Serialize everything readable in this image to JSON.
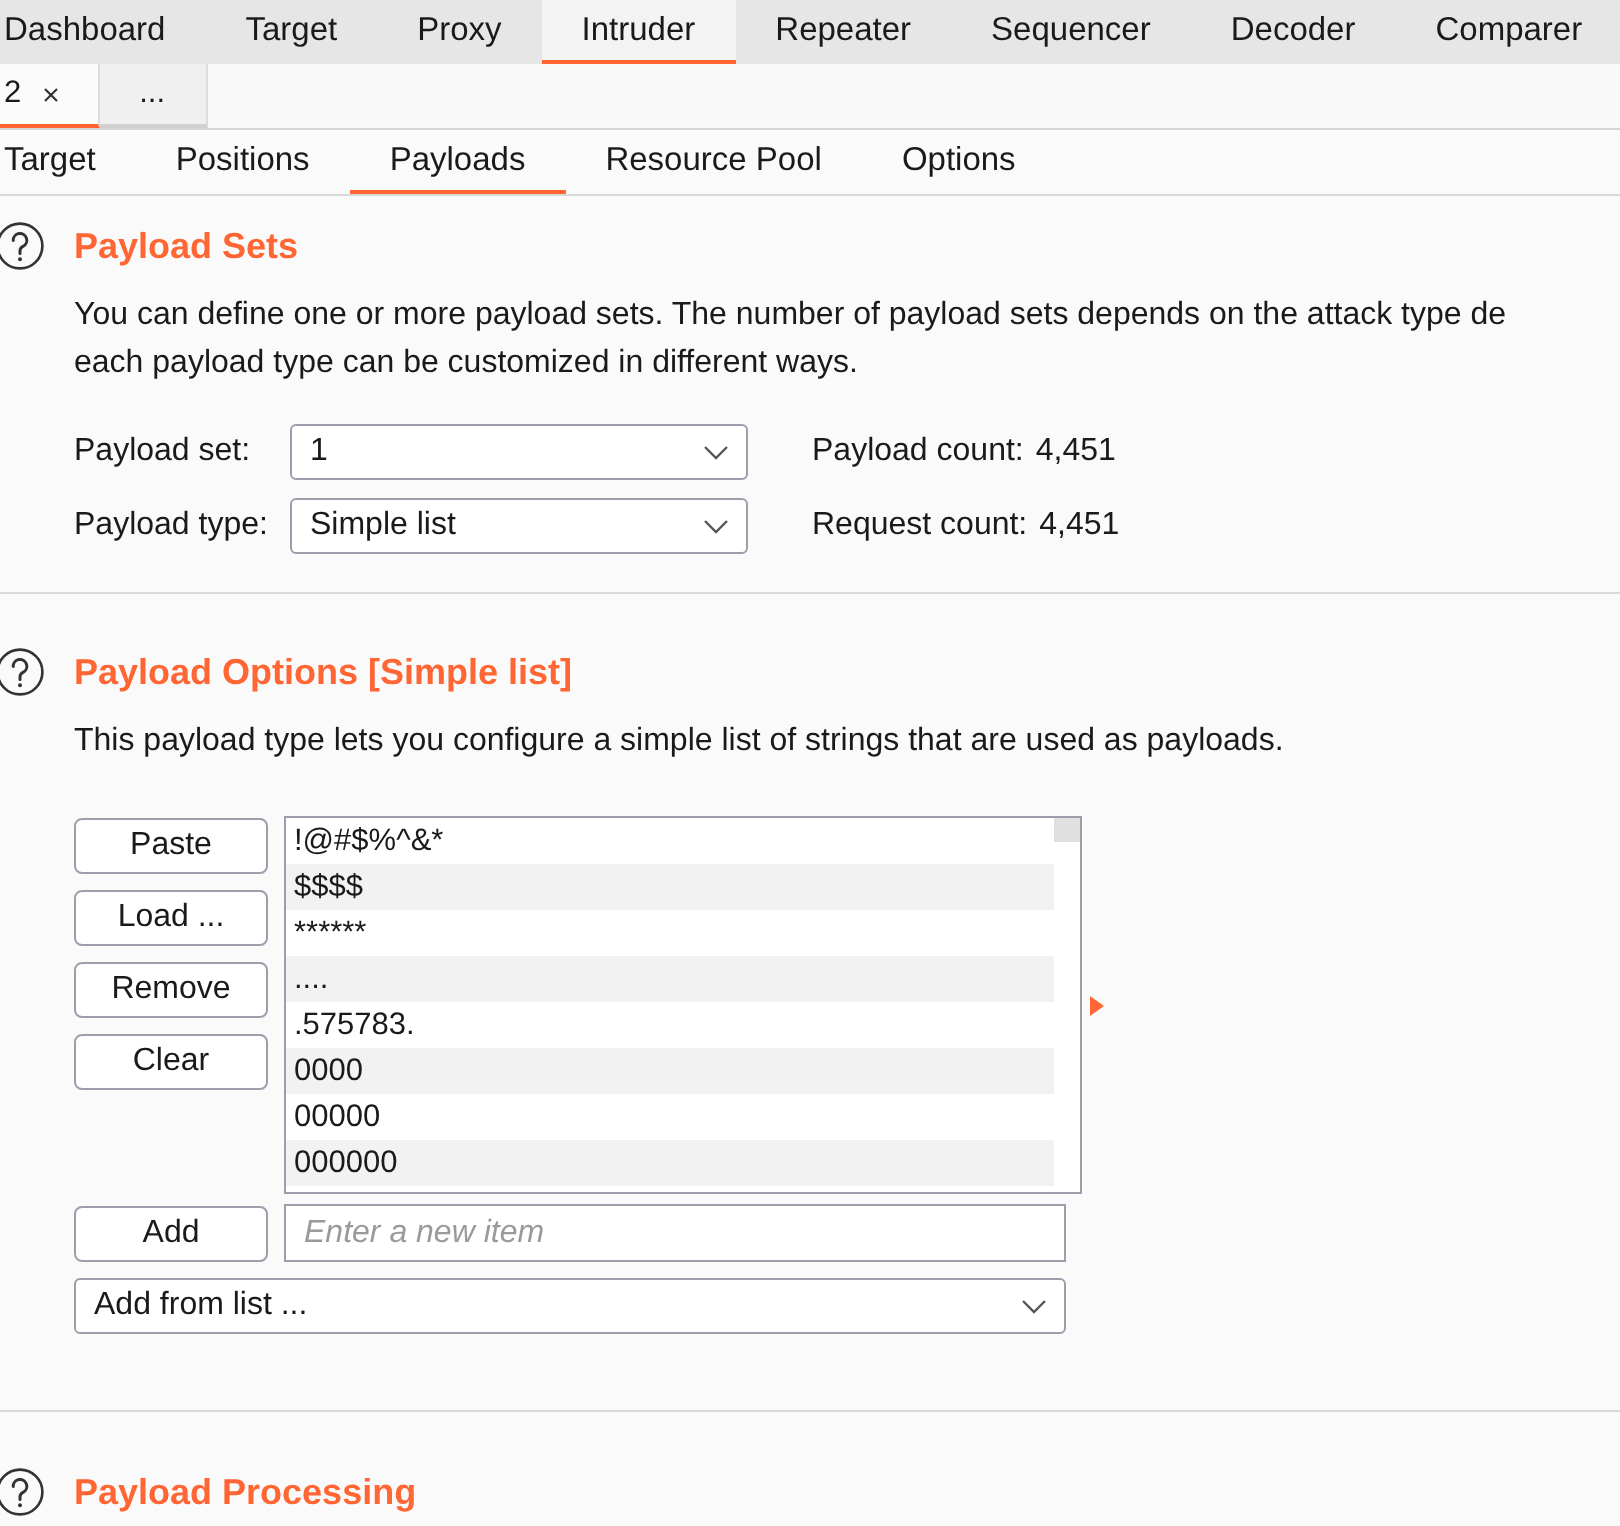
{
  "top_tabs": [
    {
      "label": "Dashboard",
      "selected": false
    },
    {
      "label": "Target",
      "selected": false
    },
    {
      "label": "Proxy",
      "selected": false
    },
    {
      "label": "Intruder",
      "selected": true
    },
    {
      "label": "Repeater",
      "selected": false
    },
    {
      "label": "Sequencer",
      "selected": false
    },
    {
      "label": "Decoder",
      "selected": false
    },
    {
      "label": "Comparer",
      "selected": false
    }
  ],
  "attack_tabs": [
    {
      "label": "2",
      "closable": true,
      "selected": true
    },
    {
      "label": "...",
      "closable": false,
      "selected": false
    }
  ],
  "sub_tabs": [
    {
      "label": "Target",
      "selected": false
    },
    {
      "label": "Positions",
      "selected": false
    },
    {
      "label": "Payloads",
      "selected": true
    },
    {
      "label": "Resource Pool",
      "selected": false
    },
    {
      "label": "Options",
      "selected": false
    }
  ],
  "payload_sets": {
    "title": "Payload Sets",
    "description": "You can define one or more payload sets. The number of payload sets depends on the attack type de\neach payload type can be customized in different ways.",
    "fields": [
      {
        "label": "Payload set:",
        "value": "1"
      },
      {
        "label": "Payload type:",
        "value": "Simple list"
      }
    ],
    "counts": [
      {
        "label": "Payload count:",
        "value": "4,451"
      },
      {
        "label": "Request count:",
        "value": "4,451"
      }
    ]
  },
  "payload_options": {
    "title": "Payload Options [Simple list]",
    "description": "This payload type lets you configure a simple list of strings that are used as payloads.",
    "buttons": [
      "Paste",
      "Load ...",
      "Remove",
      "Clear"
    ],
    "items": [
      "!@#$%^&*",
      "$$$$",
      "******",
      "....",
      ".575783.",
      "0000",
      "00000",
      "000000"
    ],
    "add_button": "Add",
    "add_field": {
      "placeholder": "Enter a new item"
    },
    "add_from_list": {
      "value": "Add from list ..."
    }
  },
  "payload_processing": {
    "title": "Payload Processing"
  }
}
